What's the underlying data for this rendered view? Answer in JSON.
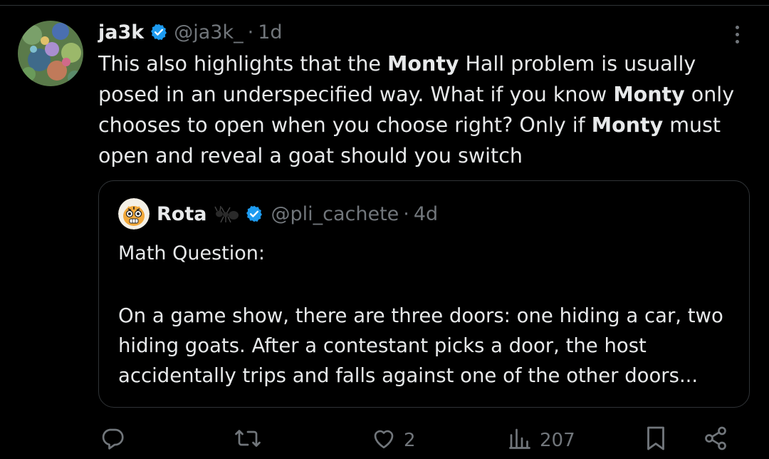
{
  "tweet": {
    "display_name": "ja3k",
    "handle": "@ja3k_",
    "separator": "·",
    "time": "1d",
    "body_parts": [
      {
        "text": "This also highlights that the ",
        "bold": false
      },
      {
        "text": "Monty",
        "bold": true
      },
      {
        "text": " Hall problem is usually posed in an underspecified way. What if you know ",
        "bold": false
      },
      {
        "text": "Monty",
        "bold": true
      },
      {
        "text": " only chooses to open when you choose right? Only if ",
        "bold": false
      },
      {
        "text": "Monty",
        "bold": true
      },
      {
        "text": " must open and reveal a goat should you switch",
        "bold": false
      }
    ]
  },
  "quote": {
    "display_name": "Rota",
    "handle": "@pli_cachete",
    "separator": "·",
    "time": "4d",
    "title": "Math Question:",
    "body": "On a game show, there are three doors: one hiding a car, two hiding goats. After a contestant picks a door, the host accidentally trips and falls against one of the other doors..."
  },
  "actions": {
    "reply_count": "",
    "repost_count": "",
    "like_count": "2",
    "view_count": "207"
  },
  "colors": {
    "background": "#000000",
    "text": "#e7e9ea",
    "muted": "#71767b",
    "border": "#2f3336",
    "verified": "#1d9bf0"
  },
  "icons": [
    "verified-badge-icon",
    "more-icon",
    "ant-emoji-icon",
    "reply-icon",
    "repost-icon",
    "like-icon",
    "views-icon",
    "bookmark-icon",
    "share-icon"
  ]
}
